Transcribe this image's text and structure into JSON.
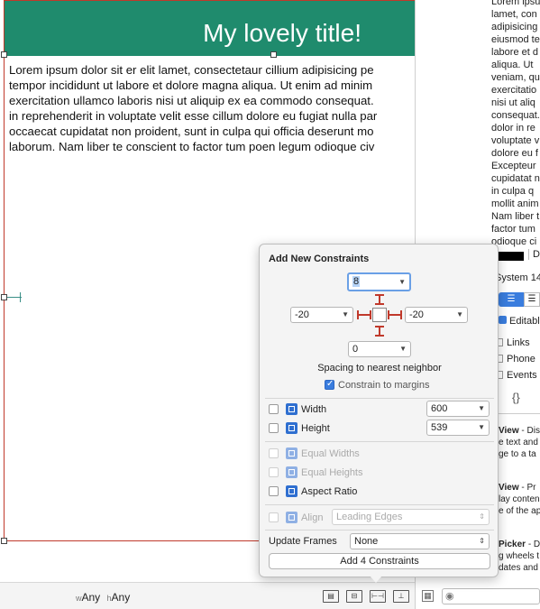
{
  "canvas": {
    "title": "My lovely title!",
    "text_lines": [
      "Lorem ipsum dolor sit er elit lamet, consectetaur cillium adipisicing pe",
      "tempor incididunt ut labore et dolore magna aliqua. Ut enim ad minim",
      "exercitation ullamco laboris nisi ut aliquip ex ea commodo consequat.",
      "in reprehenderit in voluptate velit esse cillum dolore eu fugiat nulla par",
      "occaecat cupidatat non proident, sunt in culpa qui officia deserunt mo",
      "laborum. Nam liber te conscient to factor tum poen legum odioque civ"
    ],
    "header_color": "#1f8b6d",
    "border_color": "#c0392b"
  },
  "inspector": {
    "text_lines": [
      "Lorem ipsu",
      "lamet, con",
      "adipisicing",
      "eiusmod te",
      "labore et d",
      "aliqua. Ut",
      "veniam, qu",
      "exercitatio",
      "nisi ut aliq",
      "consequat.",
      "dolor in re",
      "voluptate v",
      "dolore eu f",
      "Excepteur",
      "cupidatat n",
      "in culpa q",
      "mollit anim",
      "Nam liber t",
      "factor tum",
      "odioque ci"
    ],
    "font_value": "System 14",
    "editable_label": "Editable",
    "detection": [
      "Links",
      "Phone",
      "Events"
    ],
    "braces": "{}",
    "d_label": "D",
    "library_items": [
      {
        "name": "View",
        "desc": [
          "- Disp",
          "e text and",
          "ge to a ta"
        ]
      },
      {
        "name": "View",
        "desc": [
          "- Pr",
          "lay conten",
          "e of the ap"
        ]
      },
      {
        "name": "Picker",
        "desc": [
          "- D",
          "g wheels t",
          "dates and"
        ]
      }
    ]
  },
  "popover": {
    "title": "Add New Constraints",
    "top_value": "8",
    "left_value": "-20",
    "right_value": "-20",
    "bottom_value": "0",
    "spacing_label": "Spacing to nearest neighbor",
    "margins_label": "Constrain to margins",
    "margins_checked": true,
    "width_label": "Width",
    "width_value": "600",
    "height_label": "Height",
    "height_value": "539",
    "equal_widths_label": "Equal Widths",
    "equal_heights_label": "Equal Heights",
    "aspect_ratio_label": "Aspect Ratio",
    "align_label": "Align",
    "align_value": "Leading Edges",
    "update_frames_label": "Update Frames",
    "update_frames_value": "None",
    "add_button_label": "Add 4 Constraints"
  },
  "bottom_bar": {
    "w_prefix": "w",
    "w_value": "Any",
    "h_prefix": "h",
    "h_value": "Any",
    "tools": [
      "stack-icon",
      "align-icon",
      "pin-icon",
      "resolve-icon"
    ]
  }
}
